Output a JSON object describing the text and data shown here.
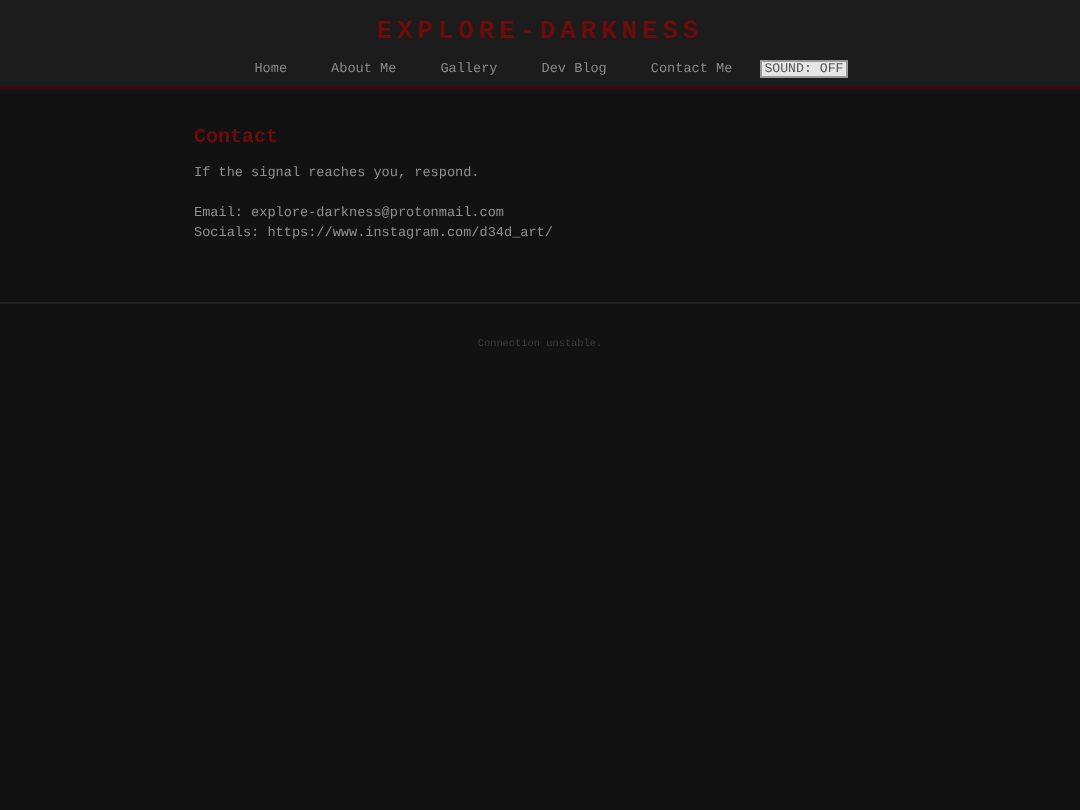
{
  "site_title": "EXPLORE-DARKNESS",
  "nav": [
    {
      "label": "Home"
    },
    {
      "label": "About Me"
    },
    {
      "label": "Gallery"
    },
    {
      "label": "Dev Blog"
    },
    {
      "label": "Contact Me"
    }
  ],
  "sound_button": "SOUND: OFF",
  "heading": "Contact",
  "paragraphs": [
    "If the signal reaches you, respond.",
    "Email: explore-darkness@protonmail.com",
    "Socials: https://www.instagram.com/d34d_art/"
  ],
  "footer": "Connection unstable."
}
